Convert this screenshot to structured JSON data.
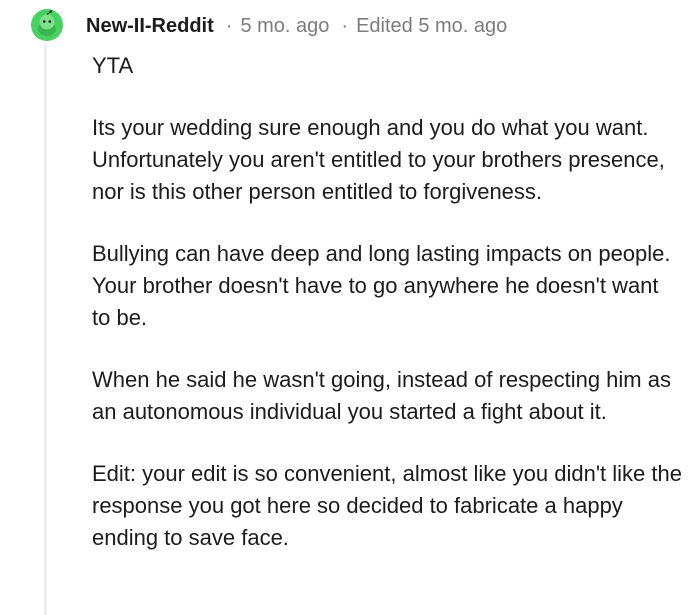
{
  "comment": {
    "author": "New-II-Reddit",
    "posted": "5 mo. ago",
    "edited": "Edited 5 mo. ago",
    "avatar_icon": "snoo-avatar-icon",
    "accent_color": "#46d160",
    "paragraphs": [
      "YTA",
      "Its your wedding sure enough and you do what you want. Unfortunately you aren't entitled to your brothers presence, nor is this other person entitled to forgiveness.",
      "Bullying can have deep and long lasting impacts on people. Your brother doesn't have to go anywhere he doesn't want to be.",
      "When he said he wasn't going, instead of respecting him as an autonomous individual you started a fight about it.",
      "Edit: your edit is so convenient, almost like you didn't like the response you got here so decided to fabricate a happy ending to save face."
    ]
  }
}
